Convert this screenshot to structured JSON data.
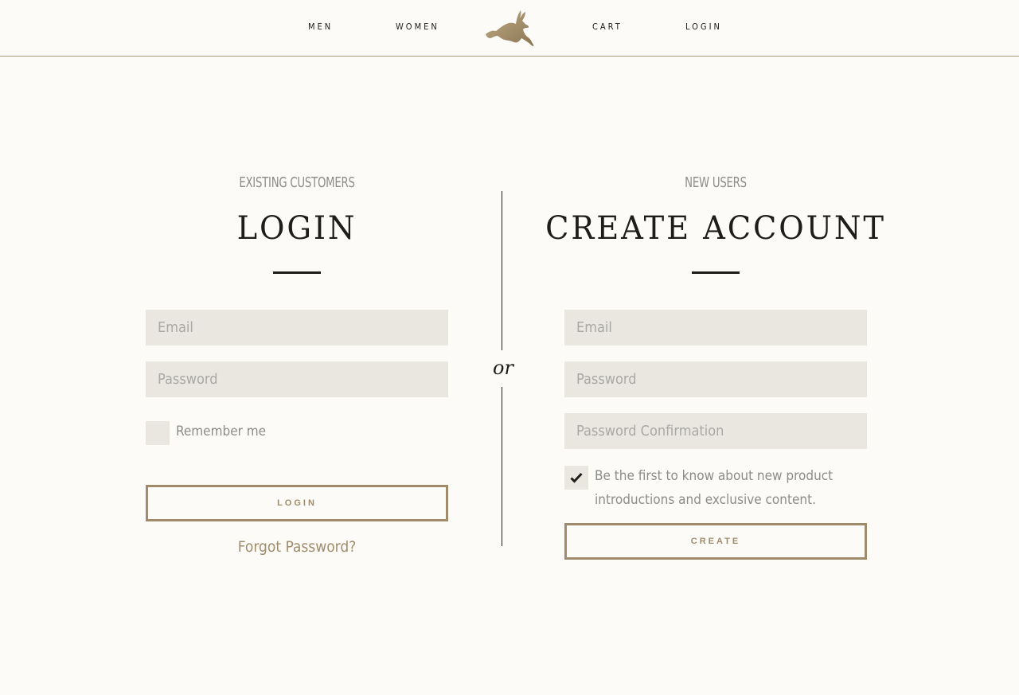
{
  "nav": {
    "men": "MEN",
    "women": "WOMEN",
    "cart": "CART",
    "login": "LOGIN",
    "logo_icon": "hare-logo-icon"
  },
  "login": {
    "eyebrow": "EXISTING CUSTOMERS",
    "title": "LOGIN",
    "email_placeholder": "Email",
    "password_placeholder": "Password",
    "remember_label": "Remember me",
    "remember_checked": false,
    "button_label": "LOGIN",
    "forgot_label": "Forgot Password?"
  },
  "divider": {
    "or_label": "or"
  },
  "create": {
    "eyebrow": "NEW USERS",
    "title": "CREATE ACCOUNT",
    "email_placeholder": "Email",
    "password_placeholder": "Password",
    "confirm_placeholder": "Password Confirmation",
    "newsletter_label": "Be the first to know about new product introductions and exclusive content.",
    "newsletter_checked": true,
    "button_label": "CREATE"
  },
  "colors": {
    "background": "#fcfbf7",
    "accent": "#a08c6b",
    "field": "#eae7e0",
    "text": "#1d1d1b",
    "muted": "#8c8c8a"
  }
}
